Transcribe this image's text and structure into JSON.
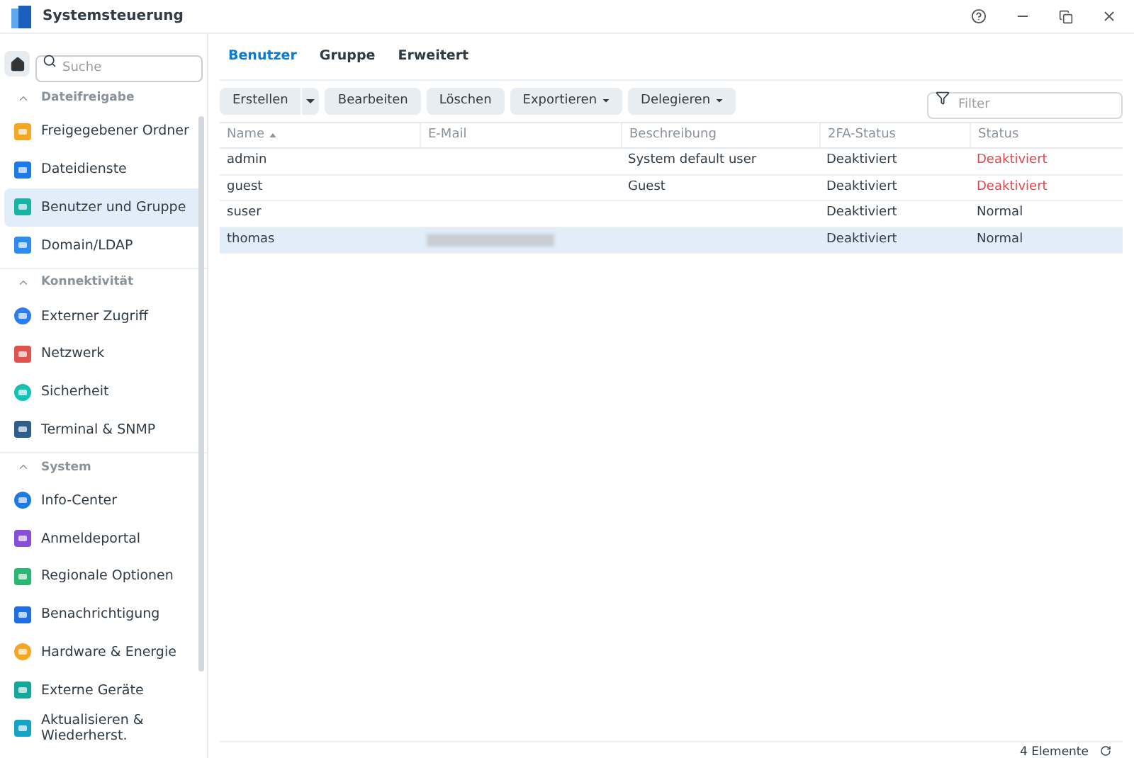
{
  "window": {
    "title": "Systemsteuerung"
  },
  "sidebar": {
    "search": {
      "placeholder": "Suche"
    },
    "sections": [
      {
        "title": "Dateifreigabe",
        "expanded": true,
        "items": [
          {
            "label": "Freigegebener Ordner",
            "selected": false
          },
          {
            "label": "Dateidienste",
            "selected": false
          },
          {
            "label": "Benutzer und Gruppe",
            "selected": true
          },
          {
            "label": "Domain/LDAP",
            "selected": false
          }
        ]
      },
      {
        "title": "Konnektivität",
        "expanded": true,
        "items": [
          {
            "label": "Externer Zugriff",
            "selected": false
          },
          {
            "label": "Netzwerk",
            "selected": false
          },
          {
            "label": "Sicherheit",
            "selected": false
          },
          {
            "label": "Terminal & SNMP",
            "selected": false
          }
        ]
      },
      {
        "title": "System",
        "expanded": true,
        "items": [
          {
            "label": "Info-Center",
            "selected": false
          },
          {
            "label": "Anmeldeportal",
            "selected": false
          },
          {
            "label": "Regionale Optionen",
            "selected": false
          },
          {
            "label": "Benachrichtigung",
            "selected": false
          },
          {
            "label": "Hardware & Energie",
            "selected": false
          },
          {
            "label": "Externe Geräte",
            "selected": false
          },
          {
            "label": "Aktualisieren & Wiederherst.",
            "selected": false
          }
        ]
      }
    ]
  },
  "tabs": [
    {
      "label": "Benutzer",
      "selected": true
    },
    {
      "label": "Gruppe",
      "selected": false
    },
    {
      "label": "Erweitert",
      "selected": false
    }
  ],
  "toolbar": {
    "buttons": [
      {
        "label": "Erstellen",
        "kind": "split"
      },
      {
        "label": "Bearbeiten",
        "kind": "plain"
      },
      {
        "label": "Löschen",
        "kind": "plain"
      },
      {
        "label": "Exportieren",
        "kind": "menu"
      },
      {
        "label": "Delegieren",
        "kind": "menu"
      }
    ],
    "filter": {
      "placeholder": "Filter"
    }
  },
  "table": {
    "columns": [
      "Name",
      "E-Mail",
      "Beschreibung",
      "2FA-Status",
      "Status"
    ],
    "rows": [
      {
        "name": "admin",
        "email_blurred": false,
        "description": "System default user",
        "twofa": "Deaktiviert",
        "status": {
          "text": "Deaktiviert",
          "kind": "alert"
        },
        "selected": false
      },
      {
        "name": "guest",
        "email_blurred": false,
        "description": "Guest",
        "twofa": "Deaktiviert",
        "status": {
          "text": "Deaktiviert",
          "kind": "alert"
        },
        "selected": false
      },
      {
        "name": "suser",
        "email_blurred": false,
        "description": "",
        "twofa": "Deaktiviert",
        "status": {
          "text": "Normal",
          "kind": "normal"
        },
        "selected": false
      },
      {
        "name": "thomas",
        "email_blurred": true,
        "description": "",
        "twofa": "Deaktiviert",
        "status": {
          "text": "Normal",
          "kind": "normal"
        },
        "selected": true
      }
    ]
  },
  "status_bar": {
    "count": "4 Elemente"
  }
}
